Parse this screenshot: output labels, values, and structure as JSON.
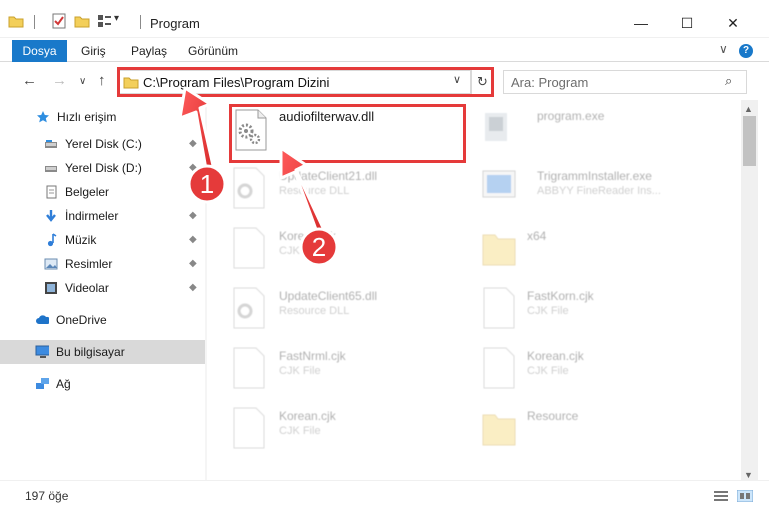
{
  "window": {
    "title": "Program",
    "minimize_glyph": "—",
    "maximize_glyph": "☐",
    "close_glyph": "✕"
  },
  "quick_access": {
    "folder_icon": "folder-icon",
    "properties_icon": "properties-icon",
    "new_folder_icon": "new-folder-icon",
    "dropdown_glyph": "▾"
  },
  "ribbon": {
    "file_tab": "Dosya",
    "tabs": [
      "Giriş",
      "Paylaş",
      "Görünüm"
    ],
    "expand_glyph": "∨",
    "help_glyph": "?"
  },
  "nav": {
    "back_glyph": "←",
    "forward_glyph": "→",
    "recent_glyph": "∨",
    "up_glyph": "↑",
    "address": "C:\\Program Files\\Program Dizini",
    "address_chevron": "∨",
    "refresh_glyph": "↻",
    "search_placeholder": "Ara: Program",
    "search_glyph": "⌕"
  },
  "sidebar": {
    "items": [
      {
        "label": "Hızlı erişim",
        "icon": "star-icon"
      },
      {
        "label": "Yerel Disk (C:)",
        "icon": "drive-icon"
      },
      {
        "label": "Yerel Disk (D:)",
        "icon": "drive-icon"
      },
      {
        "label": "Belgeler",
        "icon": "documents-icon"
      },
      {
        "label": "İndirmeler",
        "icon": "downloads-icon"
      },
      {
        "label": "Müzik",
        "icon": "music-icon"
      },
      {
        "label": "Resimler",
        "icon": "pictures-icon"
      },
      {
        "label": "Videolar",
        "icon": "videos-icon"
      },
      {
        "label": "OneDrive",
        "icon": "cloud-icon"
      },
      {
        "label": "Bu bilgisayar",
        "icon": "computer-icon"
      },
      {
        "label": "Ağ",
        "icon": "network-icon"
      }
    ],
    "pin_glyph": "📌"
  },
  "files": [
    {
      "name": "audiofilterwav.dll",
      "sub": ""
    },
    {
      "name": "program.exe",
      "sub": ""
    },
    {
      "name": "UpdateClient21.dll",
      "sub": "Resource DLL"
    },
    {
      "name": "TrigrammInstaller.exe",
      "sub": "ABBYY FineReader Ins..."
    },
    {
      "name": "Korean.cjk",
      "sub": "CJK File"
    },
    {
      "name": "x64",
      "sub": ""
    },
    {
      "name": "UpdateClient65.dll",
      "sub": "Resource DLL"
    },
    {
      "name": "FastKorn.cjk",
      "sub": "CJK File"
    },
    {
      "name": "FastNrml.cjk",
      "sub": "CJK File"
    },
    {
      "name": "Korean.cjk",
      "sub": "CJK File"
    },
    {
      "name": "Korean.cjk",
      "sub": "CJK File"
    },
    {
      "name": "Resource",
      "sub": ""
    }
  ],
  "annotations": {
    "badge1": "1",
    "badge2": "2",
    "highlight_color": "#e53a3a"
  },
  "status": {
    "item_count": "197 öğe"
  }
}
